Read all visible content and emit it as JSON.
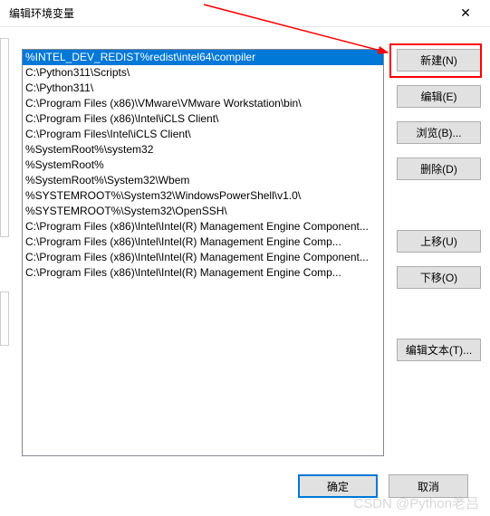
{
  "window": {
    "title": "编辑环境变量",
    "close_icon": "✕"
  },
  "list": {
    "items": [
      "%INTEL_DEV_REDIST%redist\\intel64\\compiler",
      "C:\\Python311\\Scripts\\",
      "C:\\Python311\\",
      "C:\\Program Files (x86)\\VMware\\VMware Workstation\\bin\\",
      "C:\\Program Files (x86)\\Intel\\iCLS Client\\",
      "C:\\Program Files\\Intel\\iCLS Client\\",
      "%SystemRoot%\\system32",
      "%SystemRoot%",
      "%SystemRoot%\\System32\\Wbem",
      "%SYSTEMROOT%\\System32\\WindowsPowerShell\\v1.0\\",
      "%SYSTEMROOT%\\System32\\OpenSSH\\",
      "C:\\Program Files (x86)\\Intel\\Intel(R) Management Engine Component...",
      "C:\\Program Files (x86)\\Intel\\Intel(R) Management Engine Comp...",
      "C:\\Program Files (x86)\\Intel\\Intel(R) Management Engine Component...",
      "C:\\Program Files (x86)\\Intel\\Intel(R) Management Engine Comp..."
    ],
    "selected_index": 0
  },
  "buttons": {
    "new": "新建(N)",
    "edit": "编辑(E)",
    "browse": "浏览(B)...",
    "delete": "删除(D)",
    "move_up": "上移(U)",
    "move_down": "下移(O)",
    "edit_text": "编辑文本(T)..."
  },
  "bottom": {
    "ok": "确定",
    "cancel": "取消"
  },
  "watermark": "CSDN @Python老吕"
}
